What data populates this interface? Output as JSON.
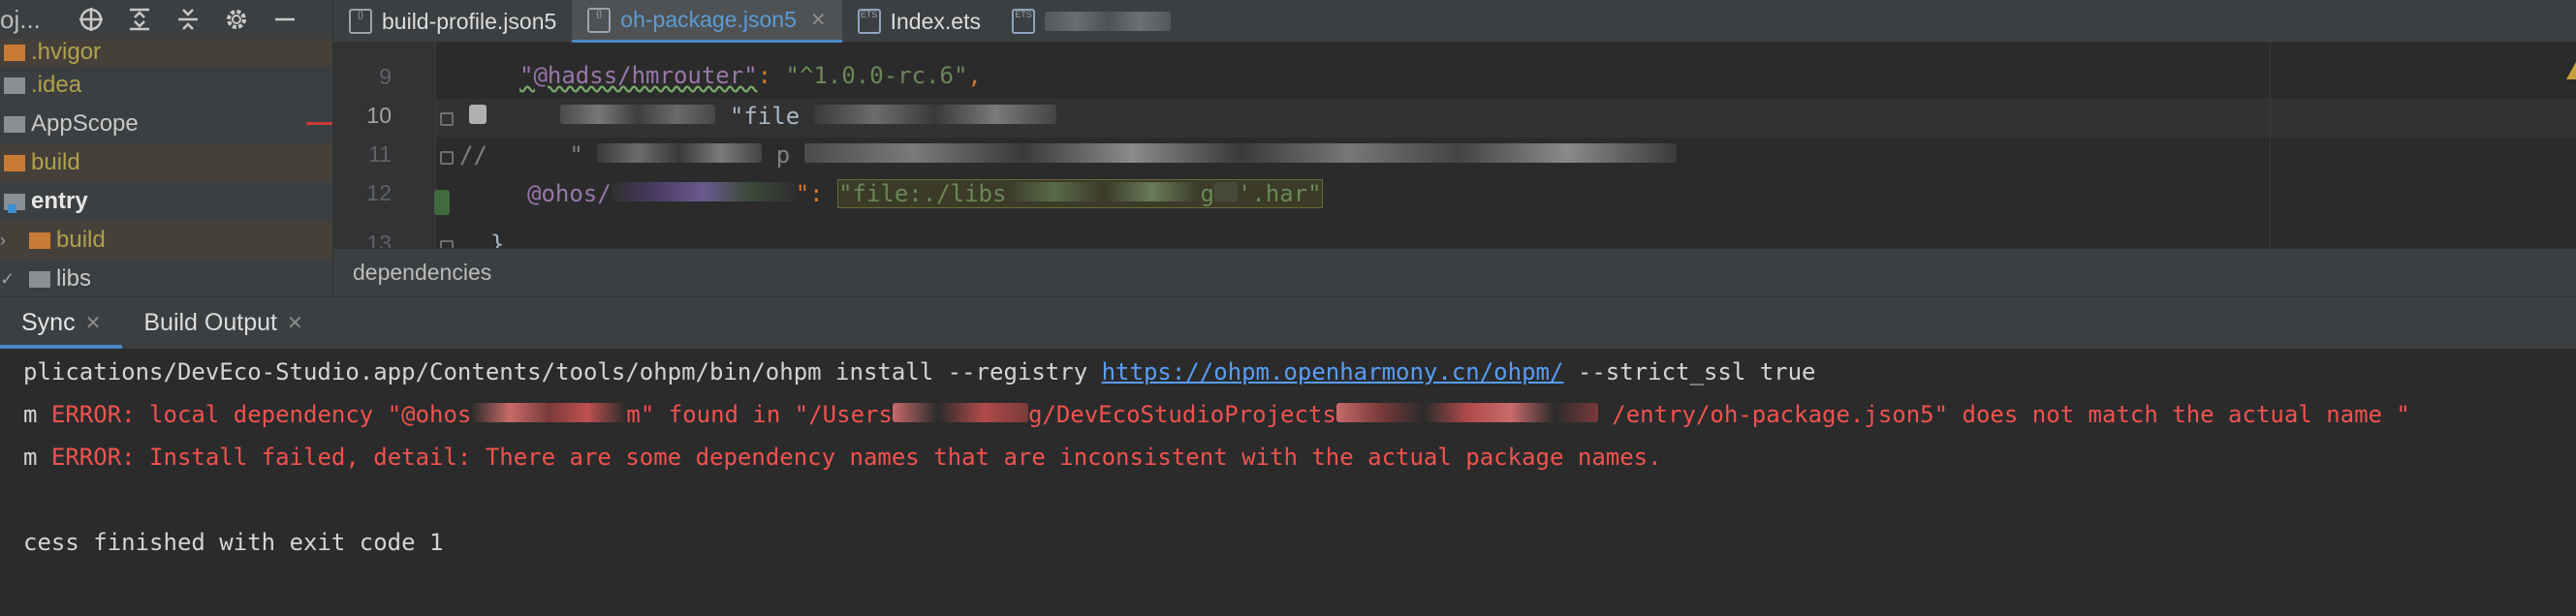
{
  "sidebar": {
    "title": "oj...",
    "toolbar_icons": [
      "target-icon",
      "expand-all-icon",
      "collapse-all-icon",
      "gear-icon",
      "minimize-icon"
    ],
    "tree": [
      {
        "label": ".hvigor",
        "type": "excluded-folder"
      },
      {
        "label": ".idea",
        "type": "folder"
      },
      {
        "label": "AppScope",
        "type": "folder"
      },
      {
        "label": "build",
        "type": "excluded-folder"
      },
      {
        "label": "entry",
        "type": "module",
        "expanded": true
      },
      {
        "label": "build",
        "type": "excluded-folder",
        "expanded": false
      },
      {
        "label": "libs",
        "type": "folder",
        "expanded": true
      }
    ]
  },
  "tabs": [
    {
      "label": "build-profile.json5",
      "active": false
    },
    {
      "label": "oh-package.json5",
      "active": true
    },
    {
      "label": "Index.ets",
      "active": false
    },
    {
      "label": "",
      "active": false
    }
  ],
  "editor": {
    "lines": [
      {
        "number": "9"
      },
      {
        "number": "10"
      },
      {
        "number": "11"
      },
      {
        "number": "12"
      },
      {
        "number": "13"
      }
    ],
    "line9_key": "\"@hadss/hmrouter\"",
    "line9_sep": ": ",
    "line9_value": "\"^1.0.0-rc.6\"",
    "line9_comma": ",",
    "line10_text": "\"file",
    "line11_comment": "//",
    "line11_frag": "\"",
    "line11_frag2": "p",
    "line12_key": "@ohos/",
    "line12_sep": "\": ",
    "line12_value_start": "\"file:./libs",
    "line12_value_mid": "g",
    "line12_value_end": "'.har\"",
    "line13_text": "}"
  },
  "breadcrumb": "dependencies",
  "bottom_tabs": [
    {
      "label": "Sync",
      "active": true
    },
    {
      "label": "Build Output",
      "active": false
    }
  ],
  "console": {
    "line1_prefix": "plications/DevEco-Studio.app/Contents/tools/ohpm/bin/ohpm install --registry ",
    "line1_link": "https://ohpm.openharmony.cn/ohpm/",
    "line1_suffix": " --strict_ssl true",
    "line2_prefix": "m ",
    "line2_error": "ERROR: local dependency \"@ohos",
    "line2_mid1": "m\" found in \"/Users",
    "line2_mid2": "g/DevEcoStudioProjects",
    "line2_end": " /entry/oh-package.json5\" does not match the actual name \"",
    "line3_prefix": "m ",
    "line3_error": "ERROR: Install failed, detail: There are some dependency names that are inconsistent with the actual package names.",
    "line5": "cess finished with exit code 1"
  },
  "colors": {
    "error": "#f0524f",
    "link": "#589df6",
    "accent": "#4a88c7"
  }
}
